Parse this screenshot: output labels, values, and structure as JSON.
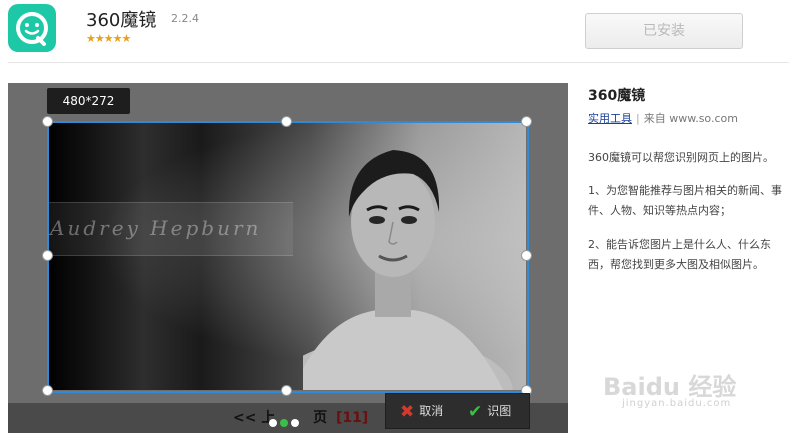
{
  "app": {
    "name": "360魔镜",
    "version": "2.2.4",
    "stars": "★★★★★",
    "install_button": "已安装"
  },
  "preview": {
    "size_label": "480*272",
    "photo_caption": "Audrey  Hepburn",
    "pager": {
      "prefix": "<< 上",
      "suffix": "页",
      "count": "[11]"
    },
    "actions": {
      "cancel": "取消",
      "identify": "识图"
    }
  },
  "info": {
    "title": "360魔镜",
    "category": "实用工具",
    "source": "来自 www.so.com",
    "description": "360魔镜可以帮您识别网页上的图片。",
    "feature1": "1、为您智能推荐与图片相关的新闻、事件、人物、知识等热点内容；",
    "feature2": "2、能告诉您图片上是什么人、什么东西，帮您找到更多大图及相似图片。"
  },
  "watermark": {
    "brand": "Baidu 经验",
    "url": "jingyan.baidu.com"
  },
  "colors": {
    "accent": "#2f8bd8",
    "icon_bg": "#1dc8a6",
    "active_dot": "#3bbf48",
    "cancel": "#d33a2c",
    "confirm": "#3bbf48"
  }
}
